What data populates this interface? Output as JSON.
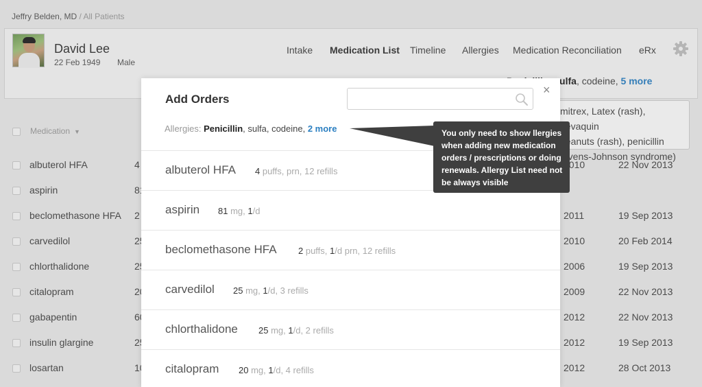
{
  "breadcrumb": {
    "user": "Jeffry Belden, MD",
    "separator": " / ",
    "section": "All Patients"
  },
  "patient": {
    "name": "David Lee",
    "dob": "22 Feb 1949",
    "sex": "Male"
  },
  "nav": [
    {
      "label": "Intake"
    },
    {
      "label": "Medication List"
    },
    {
      "label": "Timeline"
    },
    {
      "label": "Allergies"
    },
    {
      "label": "Medication Reconciliation"
    },
    {
      "label": "eRx"
    }
  ],
  "header_allergies": {
    "bold1": "Penicillin",
    "sep1": ", ",
    "bold2": "sulfa",
    "rest": ", codeine, ",
    "more": "5 more"
  },
  "allergy_popover": {
    "line1": "mitrex, Latex (rash), Levaquin",
    "line2": "peanuts (rash), penicillin",
    "line3": "tevens-Johnson syndrome)"
  },
  "med_table": {
    "header": "Medication",
    "rows": [
      {
        "name": "albuterol HFA",
        "dose": "4",
        "year": "2010",
        "date": "22 Nov 2013"
      },
      {
        "name": "aspirin",
        "dose": "81",
        "year": "",
        "date": ""
      },
      {
        "name": "beclomethasone HFA",
        "dose": "2",
        "year": "2011",
        "date": "19 Sep 2013"
      },
      {
        "name": "carvedilol",
        "dose": "25",
        "year": "2010",
        "date": "20 Feb 2014"
      },
      {
        "name": "chlorthalidone",
        "dose": "25",
        "year": "2006",
        "date": "19 Sep 2013"
      },
      {
        "name": "citalopram",
        "dose": "20",
        "year": "2009",
        "date": "22 Nov 2013"
      },
      {
        "name": "gabapentin",
        "dose": "600",
        "year": "2012",
        "date": "22 Nov 2013"
      },
      {
        "name": "insulin glargine",
        "dose": "25",
        "year": "2012",
        "date": "19 Sep 2013"
      },
      {
        "name": "losartan",
        "dose": "100",
        "year": "2012",
        "date": "28 Oct 2013"
      }
    ]
  },
  "modal": {
    "title": "Add Orders",
    "search_placeholder": "",
    "close_glyph": "×",
    "allergies": {
      "label": "Allergies: ",
      "bold": "Penicillin",
      "rest": ", sulfa, codeine, ",
      "more": "2 more"
    },
    "orders": [
      {
        "name": "albuterol HFA",
        "sig": [
          {
            "t": "4",
            "n": true
          },
          {
            "t": " puffs, prn, 12 refills",
            "n": false
          }
        ]
      },
      {
        "name": "aspirin",
        "sig": [
          {
            "t": "81",
            "n": true
          },
          {
            "t": " mg, ",
            "n": false
          },
          {
            "t": "1",
            "n": true
          },
          {
            "t": "/d",
            "n": false
          }
        ]
      },
      {
        "name": "beclomethasone HFA",
        "sig": [
          {
            "t": "2",
            "n": true
          },
          {
            "t": " puffs, ",
            "n": false
          },
          {
            "t": "1",
            "n": true
          },
          {
            "t": "/d prn, 12 refills",
            "n": false
          }
        ]
      },
      {
        "name": "carvedilol",
        "sig": [
          {
            "t": "25",
            "n": true
          },
          {
            "t": " mg, ",
            "n": false
          },
          {
            "t": "1",
            "n": true
          },
          {
            "t": "/d, 3 refills",
            "n": false
          }
        ]
      },
      {
        "name": "chlorthalidone",
        "sig": [
          {
            "t": "25",
            "n": true
          },
          {
            "t": " mg, ",
            "n": false
          },
          {
            "t": "1",
            "n": true
          },
          {
            "t": "/d, 2 refills",
            "n": false
          }
        ]
      },
      {
        "name": "citalopram",
        "sig": [
          {
            "t": "20",
            "n": true
          },
          {
            "t": " mg, ",
            "n": false
          },
          {
            "t": "1",
            "n": true
          },
          {
            "t": "/d, 4 refills",
            "n": false
          }
        ]
      }
    ]
  },
  "tooltip": {
    "text": "You only need to show llergies when adding new medication orders / prescriptions or doing renewals. Allergy List need not be always visible"
  },
  "colors": {
    "link": "#2b7fc1",
    "tooltip_bg": "#3f3f3f",
    "background": "#e8e8e8"
  },
  "icons": {
    "gear": "gear-icon",
    "search": "search-icon",
    "close": "close-icon",
    "sort": "sort-caret-icon"
  }
}
